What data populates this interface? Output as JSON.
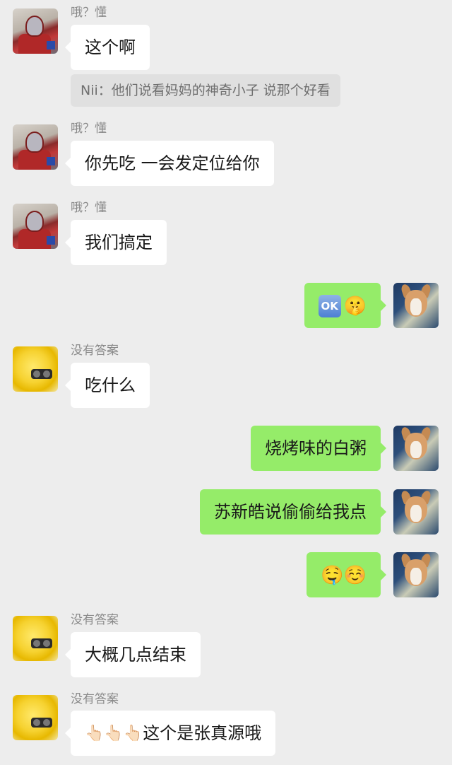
{
  "messages": [
    {
      "side": "left",
      "name": "哦？懂",
      "text": "这个啊",
      "avatar": "ultraman-avatar"
    },
    {
      "side": "quote",
      "text": "Nii：他们说看妈妈的神奇小子 说那个好看"
    },
    {
      "side": "left",
      "name": "哦？懂",
      "text": "你先吃 一会发定位给你",
      "avatar": "ultraman-avatar"
    },
    {
      "side": "left",
      "name": "哦？懂",
      "text": "我们搞定",
      "avatar": "ultraman-avatar"
    },
    {
      "side": "right",
      "ok_label": "OK",
      "emoji": "🤫",
      "avatar": "dog-avatar"
    },
    {
      "side": "left",
      "name": "没有答案",
      "text": "吃什么",
      "avatar": "yellow-avatar"
    },
    {
      "side": "right",
      "text": "烧烤味的白粥",
      "avatar": "dog-avatar"
    },
    {
      "side": "right",
      "text": "苏新皓说偷偷给我点",
      "avatar": "dog-avatar"
    },
    {
      "side": "right",
      "emoji": "🤤☺️",
      "avatar": "dog-avatar"
    },
    {
      "side": "left",
      "name": "没有答案",
      "text": "大概几点结束",
      "avatar": "yellow-avatar"
    },
    {
      "side": "left",
      "name": "没有答案",
      "emoji": "👆🏻👆🏻👆🏻",
      "text": "这个是张真源哦",
      "avatar": "yellow-avatar"
    }
  ],
  "colors": {
    "background": "#ededed",
    "incoming_bubble": "#ffffff",
    "outgoing_bubble": "#95ec69"
  }
}
